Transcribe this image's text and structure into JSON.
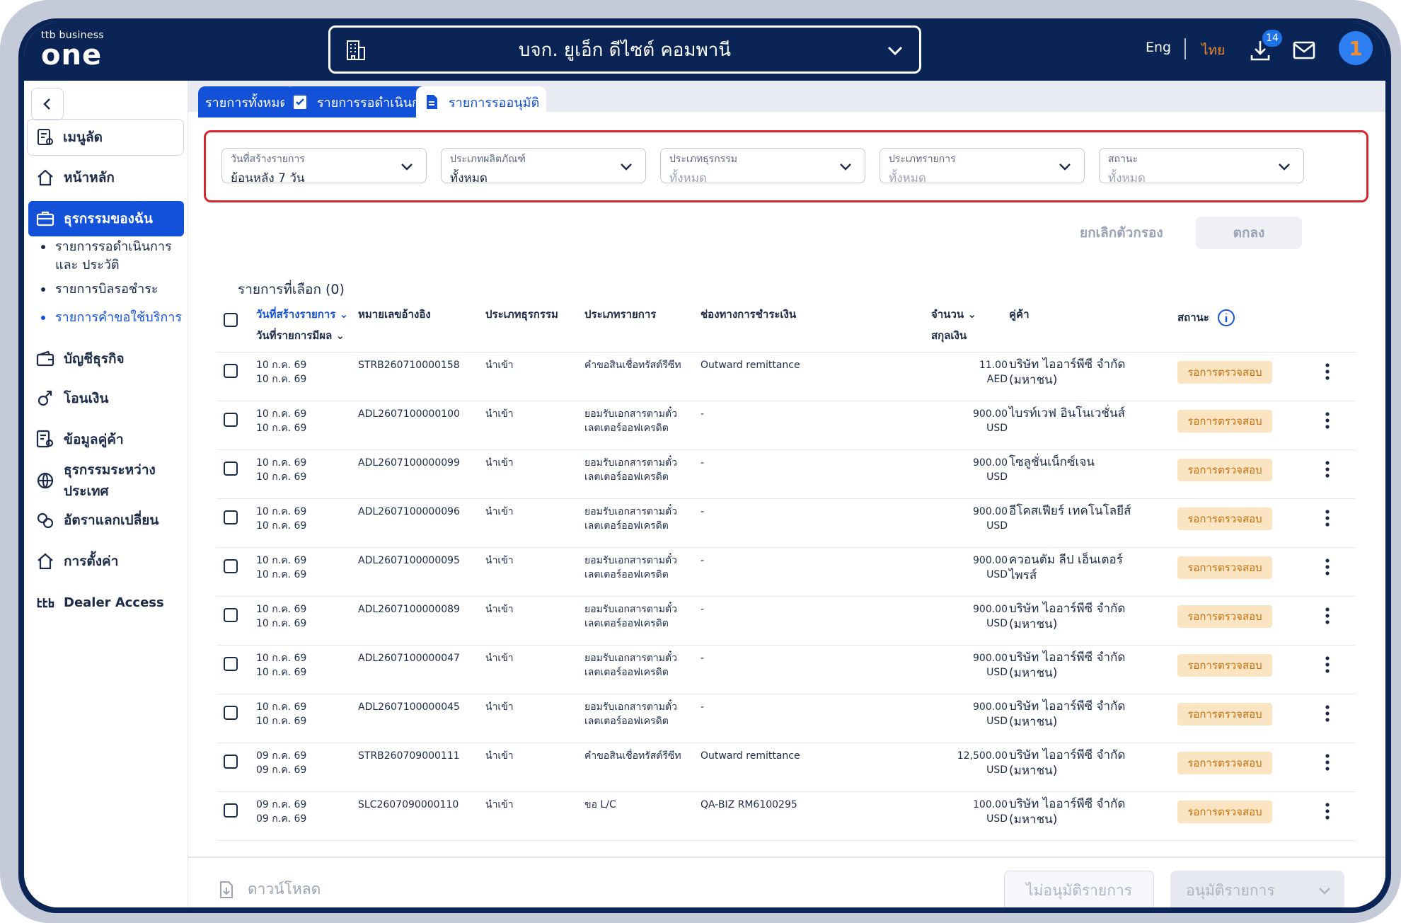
{
  "header": {
    "logo_small": "ttb business",
    "logo_big": "one",
    "company": "บจก. ยูเอ็ก ดีไซต์ คอมพานี",
    "lang_en": "Eng",
    "lang_th": "ไทย",
    "download_badge": "14",
    "avatar_letter": "1"
  },
  "sidebar": {
    "shortcut": "เมนูลัด",
    "items": [
      {
        "label": "หน้าหลัก",
        "icon": "home-icon"
      },
      {
        "label": "ธุรกรรมของฉัน",
        "icon": "briefcase-icon"
      },
      {
        "label": "บัญชีธุรกิจ",
        "icon": "wallet-icon"
      },
      {
        "label": "โอนเงิน",
        "icon": "transfer-icon"
      },
      {
        "label": "ข้อมูลคู่ค้า",
        "icon": "partner-icon"
      },
      {
        "label": "ธุรกรรมระหว่างประเทศ",
        "icon": "globe-icon"
      },
      {
        "label": "อัตราแลกเปลี่ยน",
        "icon": "exchange-icon"
      },
      {
        "label": "การตั้งค่า",
        "icon": "settings-icon"
      },
      {
        "label": "Dealer Access",
        "icon": "ttb-icon"
      }
    ],
    "subitems": [
      {
        "label": "รายการรอดำเนินการ และ ประวัติ"
      },
      {
        "label": "รายการบิลรอชำระ"
      },
      {
        "label": "รายการคำขอใช้บริการ"
      }
    ]
  },
  "tabs": [
    {
      "label": "รายการทั้งหมด"
    },
    {
      "label": "รายการรอดำเนินการ"
    },
    {
      "label": "รายการรออนุมัติ"
    }
  ],
  "filters": [
    {
      "label": "วันที่สร้างรายการ",
      "value": "ย้อนหลัง 7 วัน"
    },
    {
      "label": "ประเภทผลิตภัณฑ์",
      "value": "ทั้งหมด"
    },
    {
      "label": "ประเภทธุรกรรม",
      "value": "ทั้งหมด"
    },
    {
      "label": "ประเภทรายการ",
      "value": "ทั้งหมด"
    },
    {
      "label": "สถานะ",
      "value": "ทั้งหมด"
    }
  ],
  "filter_actions": {
    "cancel": "ยกเลิกตัวกรอง",
    "ok": "ตกลง"
  },
  "selected_count": "รายการที่เลือก (0)",
  "columns": {
    "created_date": "วันที่สร้างรายการ",
    "effective_date": "วันที่รายการมีผล",
    "reference": "หมายเลขอ้างอิง",
    "txn_type": "ประเภทธุรกรรม",
    "item_type": "ประเภทรายการ",
    "channel": "ช่องทางการชำระเงิน",
    "amount": "จำนวน",
    "currency": "สกุลเงิน",
    "partner": "คู่ค้า",
    "status": "สถานะ"
  },
  "rows": [
    {
      "d1": "10 ก.ค. 69",
      "d2": "10 ก.ค. 69",
      "ref": "STRB260710000158",
      "txn": "นำเข้า",
      "item1": "คำขอสินเชื่อทรัสต์รีซีท",
      "item2": "",
      "channel": "Outward remittance",
      "amount": "11.00",
      "ccy": "AED",
      "party": "บริษัท ไออาร์พีซี จำกัด (มหาชน)",
      "status": "รอการตรวจสอบ"
    },
    {
      "d1": "10 ก.ค. 69",
      "d2": "10 ก.ค. 69",
      "ref": "ADL2607100000100",
      "txn": "นำเข้า",
      "item1": "ยอมรับเอกสารตามตั๋ว",
      "item2": "เลตเตอร์ออฟเครดิต",
      "channel": "-",
      "amount": "900.00",
      "ccy": "USD",
      "party": "ไบรท์เวฟ อินโนเวชั่นส์",
      "status": "รอการตรวจสอบ"
    },
    {
      "d1": "10 ก.ค. 69",
      "d2": "10 ก.ค. 69",
      "ref": "ADL2607100000099",
      "txn": "นำเข้า",
      "item1": "ยอมรับเอกสารตามตั๋ว",
      "item2": "เลตเตอร์ออฟเครดิต",
      "channel": "-",
      "amount": "900.00",
      "ccy": "USD",
      "party": "โซลูชั่นเน็กซ์เจน",
      "status": "รอการตรวจสอบ"
    },
    {
      "d1": "10 ก.ค. 69",
      "d2": "10 ก.ค. 69",
      "ref": "ADL2607100000096",
      "txn": "นำเข้า",
      "item1": "ยอมรับเอกสารตามตั๋ว",
      "item2": "เลตเตอร์ออฟเครดิต",
      "channel": "-",
      "amount": "900.00",
      "ccy": "USD",
      "party": "อีโคสเฟียร์ เทคโนโลยีส์",
      "status": "รอการตรวจสอบ"
    },
    {
      "d1": "10 ก.ค. 69",
      "d2": "10 ก.ค. 69",
      "ref": "ADL2607100000095",
      "txn": "นำเข้า",
      "item1": "ยอมรับเอกสารตามตั๋ว",
      "item2": "เลตเตอร์ออฟเครดิต",
      "channel": "-",
      "amount": "900.00",
      "ccy": "USD",
      "party": "ควอนตัม ลีป เอ็นเตอร์ไพรส์",
      "status": "รอการตรวจสอบ"
    },
    {
      "d1": "10 ก.ค. 69",
      "d2": "10 ก.ค. 69",
      "ref": "ADL2607100000089",
      "txn": "นำเข้า",
      "item1": "ยอมรับเอกสารตามตั๋ว",
      "item2": "เลตเตอร์ออฟเครดิต",
      "channel": "-",
      "amount": "900.00",
      "ccy": "USD",
      "party": "บริษัท ไออาร์พีซี จำกัด (มหาชน)",
      "status": "รอการตรวจสอบ"
    },
    {
      "d1": "10 ก.ค. 69",
      "d2": "10 ก.ค. 69",
      "ref": "ADL2607100000047",
      "txn": "นำเข้า",
      "item1": "ยอมรับเอกสารตามตั๋ว",
      "item2": "เลตเตอร์ออฟเครดิต",
      "channel": "-",
      "amount": "900.00",
      "ccy": "USD",
      "party": "บริษัท ไออาร์พีซี จำกัด (มหาชน)",
      "status": "รอการตรวจสอบ"
    },
    {
      "d1": "10 ก.ค. 69",
      "d2": "10 ก.ค. 69",
      "ref": "ADL2607100000045",
      "txn": "นำเข้า",
      "item1": "ยอมรับเอกสารตามตั๋ว",
      "item2": "เลตเตอร์ออฟเครดิต",
      "channel": "-",
      "amount": "900.00",
      "ccy": "USD",
      "party": "บริษัท ไออาร์พีซี จำกัด (มหาชน)",
      "status": "รอการตรวจสอบ"
    },
    {
      "d1": "09 ก.ค. 69",
      "d2": "09 ก.ค. 69",
      "ref": "STRB260709000111",
      "txn": "นำเข้า",
      "item1": "คำขอสินเชื่อทรัสต์รีซีท",
      "item2": "",
      "channel": "Outward remittance",
      "amount": "12,500.00",
      "ccy": "USD",
      "party": "บริษัท ไออาร์พีซี จำกัด (มหาชน)",
      "status": "รอการตรวจสอบ"
    },
    {
      "d1": "09 ก.ค. 69",
      "d2": "09 ก.ค. 69",
      "ref": "SLC2607090000110",
      "txn": "นำเข้า",
      "item1": "ขอ L/C",
      "item2": "",
      "channel": "QA-BIZ RM6100295",
      "amount": "100.00",
      "ccy": "USD",
      "party": "บริษัท ไออาร์พีซี จำกัด (มหาชน)",
      "status": "รอการตรวจสอบ"
    }
  ],
  "footer": {
    "download": "ดาวน์โหลด",
    "reject": "ไม่อนุมัติรายการ",
    "approve": "อนุมัติรายการ"
  },
  "colors": {
    "navy": "#0b2456",
    "primary": "#1351d8",
    "accent": "#f08c2a",
    "filter_border": "#d8262d",
    "status_bg": "#fbe4c2"
  }
}
